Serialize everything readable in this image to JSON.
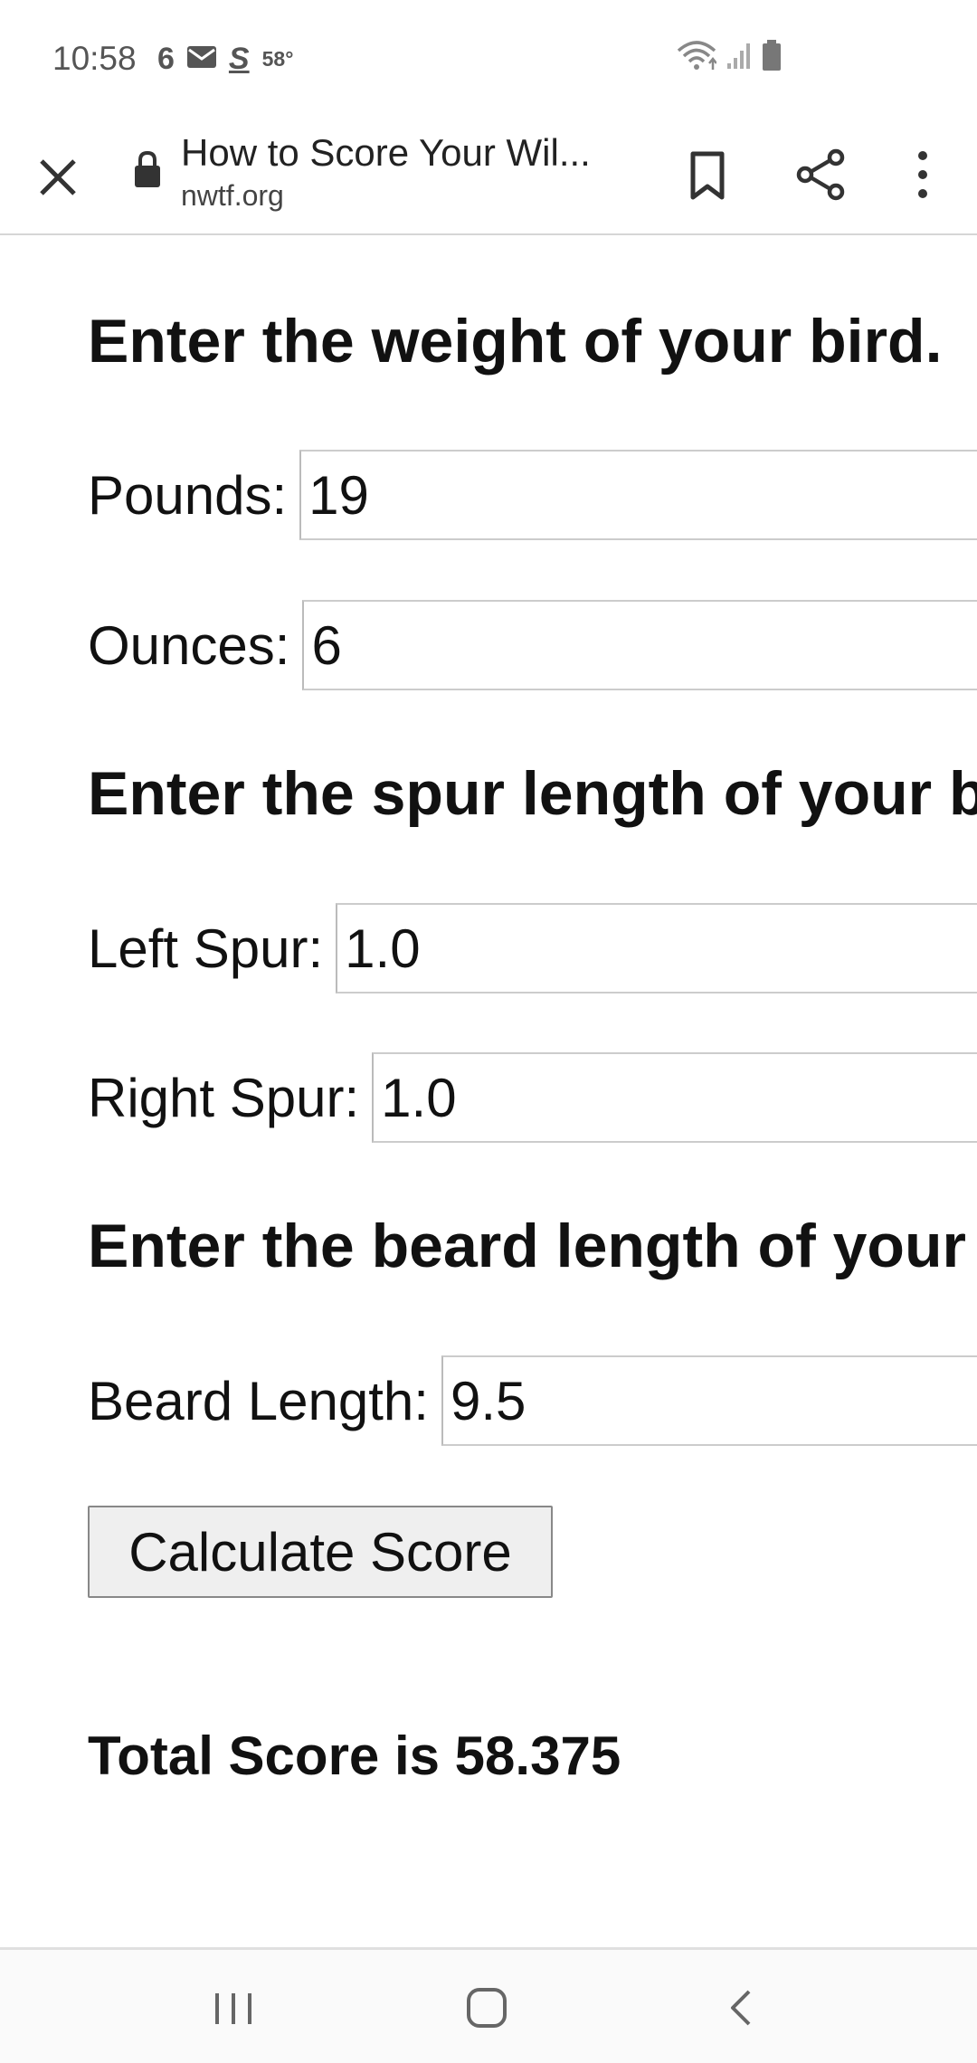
{
  "status_bar": {
    "time": "10:58",
    "notifications": [
      "6",
      "mail",
      "S"
    ],
    "notif_6": "6",
    "notif_s": "S",
    "temperature": "58°"
  },
  "browser": {
    "page_title": "How to Score Your Wil...",
    "domain": "nwtf.org"
  },
  "form": {
    "weight_heading": "Enter the weight of your bird.",
    "pounds_label": "Pounds:",
    "pounds_value": "19",
    "ounces_label": "Ounces:",
    "ounces_value": "6",
    "spur_heading": "Enter the spur length of your bird.",
    "left_spur_label": "Left Spur:",
    "left_spur_value": "1.0",
    "right_spur_label": "Right Spur:",
    "right_spur_value": "1.0",
    "beard_heading": "Enter the beard length of your bird.",
    "beard_label": "Beard Length:",
    "beard_value": "9.5",
    "calculate_label": "Calculate Score",
    "total_score": "Total Score is 58.375"
  },
  "icons": {
    "close": "close-icon",
    "lock": "lock-icon",
    "bookmark": "bookmark-icon",
    "share": "share-icon",
    "more": "more-vert-icon",
    "recents": "recents-icon",
    "home": "home-icon",
    "back": "back-icon"
  }
}
